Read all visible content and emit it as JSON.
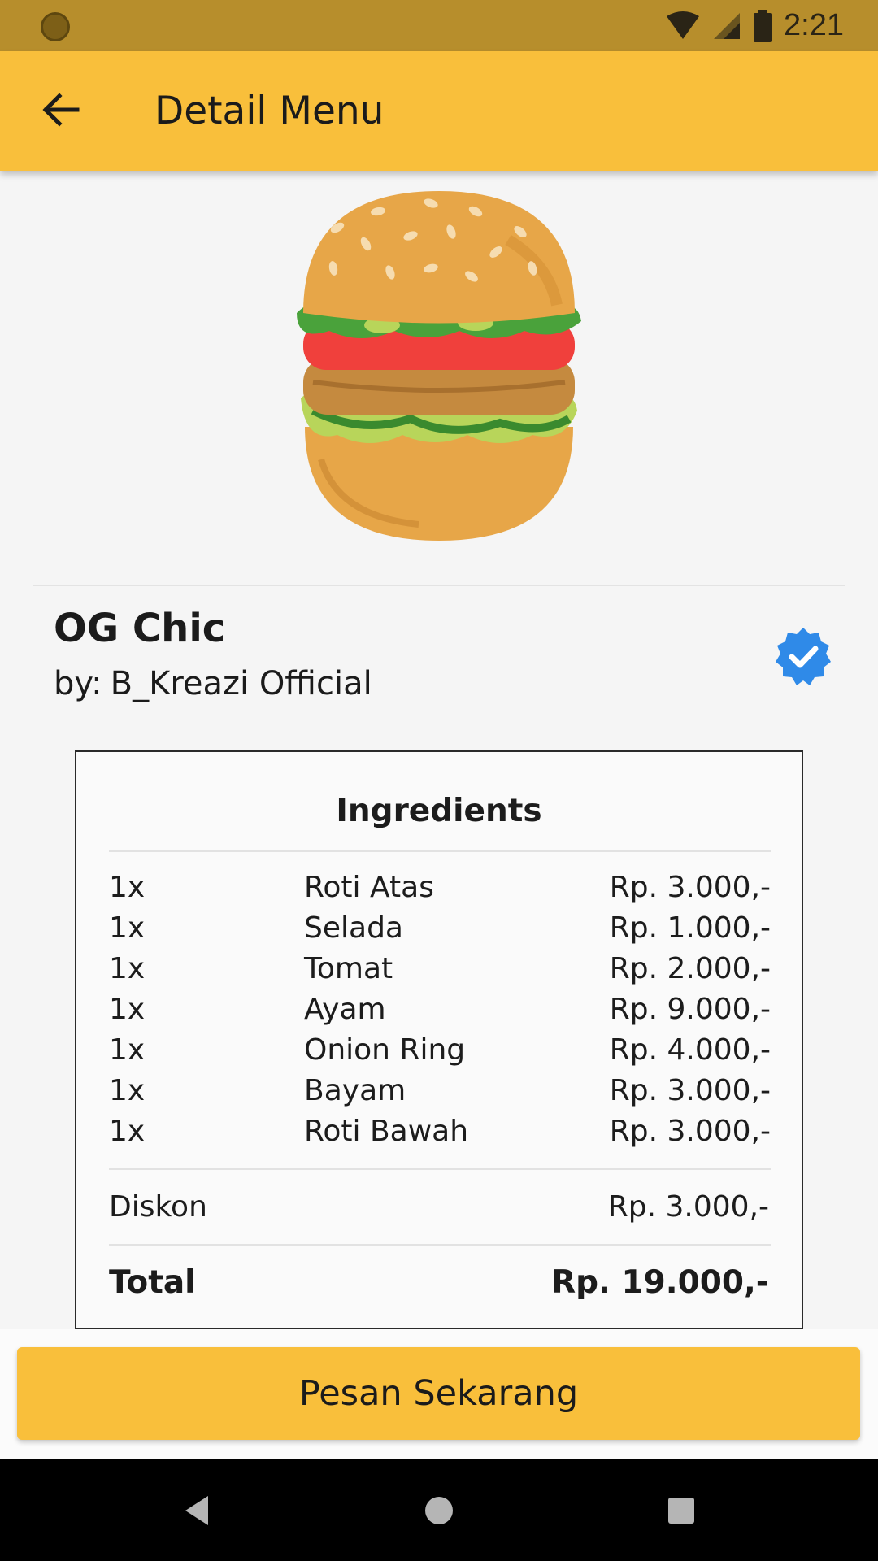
{
  "status_bar": {
    "time": "2:21",
    "icons": [
      "notification-dot-icon",
      "wifi-icon",
      "signal-icon",
      "battery-icon"
    ]
  },
  "app_bar": {
    "title": "Detail Menu",
    "back_icon": "arrow-left-icon"
  },
  "menu": {
    "image": "burger-image",
    "name": "OG Chic",
    "author_prefix": "by:",
    "author_name": "B_Kreazi Official",
    "verified_icon": "verified-badge-icon",
    "verified_color": "#2f8ae8"
  },
  "ingredients": {
    "title": "Ingredients",
    "items": [
      {
        "qty": "1x",
        "name": "Roti Atas",
        "price": "Rp. 3.000,-"
      },
      {
        "qty": "1x",
        "name": "Selada",
        "price": "Rp. 1.000,-"
      },
      {
        "qty": "1x",
        "name": "Tomat",
        "price": "Rp. 2.000,-"
      },
      {
        "qty": "1x",
        "name": "Ayam",
        "price": "Rp. 9.000,-"
      },
      {
        "qty": "1x",
        "name": "Onion Ring",
        "price": "Rp. 4.000,-"
      },
      {
        "qty": "1x",
        "name": "Bayam",
        "price": "Rp. 3.000,-"
      },
      {
        "qty": "1x",
        "name": "Roti Bawah",
        "price": "Rp. 3.000,-"
      }
    ],
    "discount_label": "Diskon",
    "discount_value": "Rp. 3.000,-",
    "total_label": "Total",
    "total_value": "Rp. 19.000,-"
  },
  "actions": {
    "order_label": "Pesan Sekarang"
  },
  "colors": {
    "primary": "#f9bf3b",
    "status_bar": "#b78e2c"
  },
  "nav_bar": {
    "icons": [
      "back-triangle-icon",
      "home-circle-icon",
      "recents-square-icon"
    ]
  }
}
